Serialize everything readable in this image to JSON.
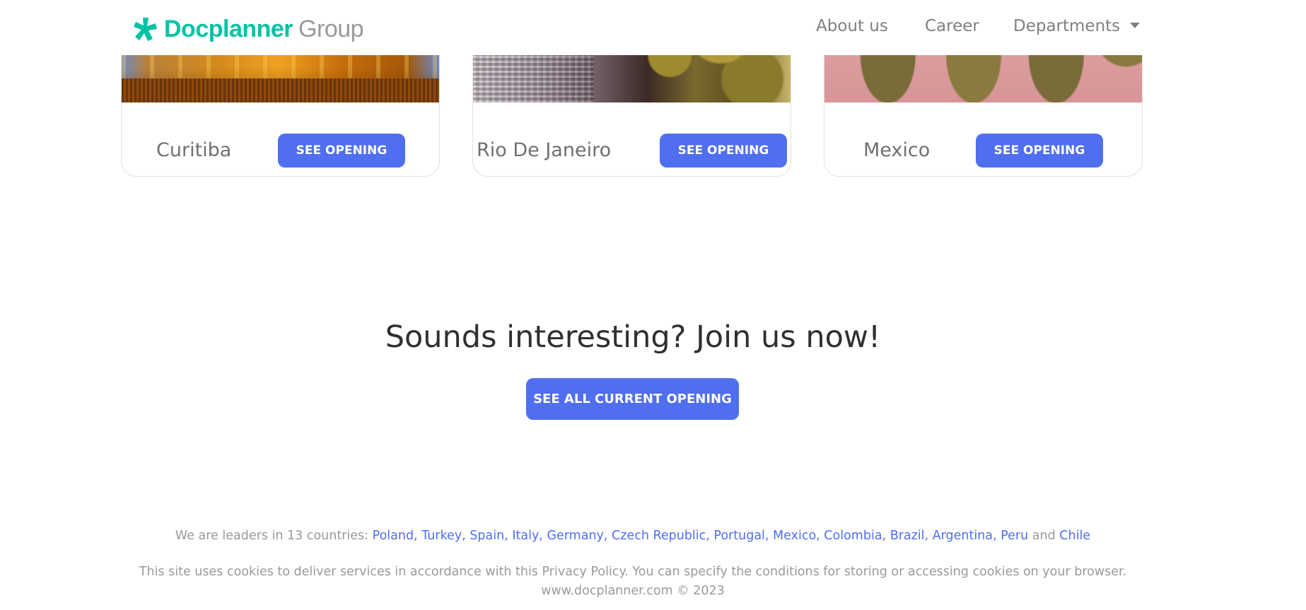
{
  "header": {
    "logo_brand": "Docplanner",
    "logo_group": "Group",
    "nav": {
      "about": "About us",
      "career": "Career",
      "departments": "Departments"
    }
  },
  "cards": [
    {
      "city": "Curitiba",
      "button": "SEE OPENING"
    },
    {
      "city": "Rio De Janeiro",
      "button": "SEE OPENING"
    },
    {
      "city": "Mexico",
      "button": "SEE OPENING"
    }
  ],
  "cta": {
    "title": "Sounds interesting? Join us now!",
    "button": "SEE ALL CURRENT OPENING"
  },
  "footer": {
    "countries_intro": "We are leaders in 13 countries:",
    "countries": [
      "Poland",
      "Turkey",
      "Spain",
      "Italy",
      "Germany",
      "Czech Republic",
      "Portugal",
      "Mexico",
      "Colombia",
      "Brazil",
      "Argentina",
      "Peru"
    ],
    "and_word": "and",
    "last_country": "Chile",
    "cookies": "This site uses cookies to deliver services in accordance with this Privacy Policy. You can specify the conditions for storing or accessing cookies on your browser.",
    "copyright": "www.docplanner.com © 2023"
  },
  "colors": {
    "brand": "#00c3a5",
    "accent": "#4f6ef0"
  }
}
